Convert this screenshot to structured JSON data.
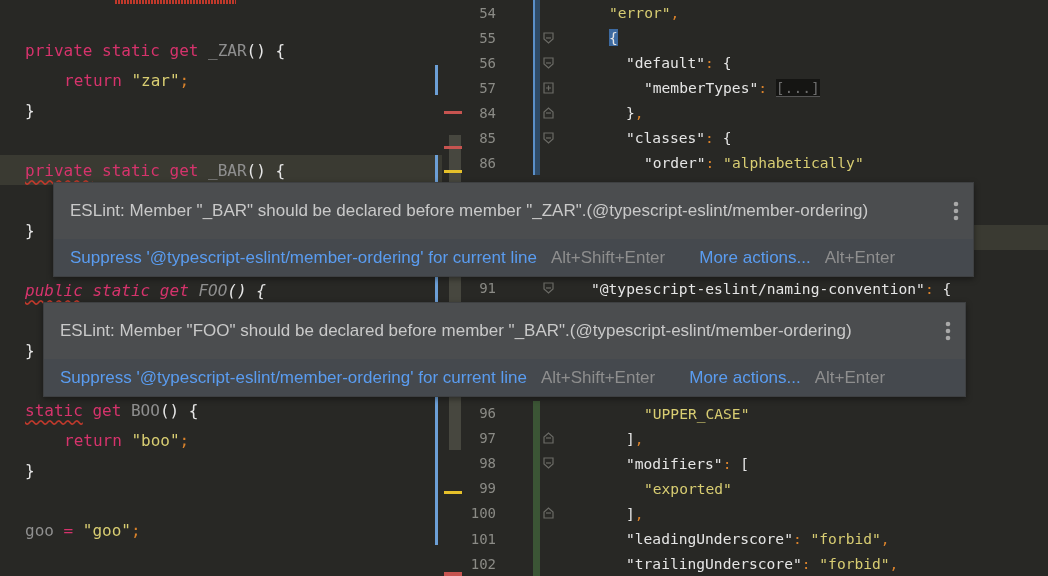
{
  "left_editor": {
    "lines": [
      {
        "kind": "blank"
      },
      {
        "kind": "code",
        "tokens": [
          {
            "kind": "keyword",
            "text": "private static get "
          },
          {
            "kind": "ident",
            "text": "_ZAR"
          },
          {
            "kind": "punct",
            "text": "() {"
          }
        ]
      },
      {
        "kind": "body",
        "modified": true,
        "tokens": [
          {
            "kind": "keyword",
            "text": "return "
          },
          {
            "kind": "string",
            "text": "\"zar\""
          },
          {
            "kind": "semi",
            "text": ";"
          }
        ]
      },
      {
        "kind": "code",
        "tokens": [
          {
            "kind": "punct",
            "text": "}"
          }
        ]
      },
      {
        "kind": "blank"
      },
      {
        "kind": "code",
        "current": true,
        "modified": true,
        "tokens": [
          {
            "kind": "keyword",
            "text": "private",
            "squiggle": true
          },
          {
            "kind": "keyword",
            "text": " static get "
          },
          {
            "kind": "ident",
            "text": "_BAR"
          },
          {
            "kind": "punct",
            "text": "() {"
          }
        ]
      },
      {
        "kind": "blank"
      },
      {
        "kind": "code",
        "tokens": [
          {
            "kind": "punct",
            "text": "}"
          }
        ]
      },
      {
        "kind": "blank"
      },
      {
        "kind": "code",
        "modified": true,
        "italic": true,
        "tokens": [
          {
            "kind": "keyword",
            "text": "public",
            "squiggle": true
          },
          {
            "kind": "keyword",
            "text": " static get "
          },
          {
            "kind": "ident",
            "text": "FOO"
          },
          {
            "kind": "punct",
            "text": "() {"
          }
        ]
      },
      {
        "kind": "blank"
      },
      {
        "kind": "code",
        "tokens": [
          {
            "kind": "punct",
            "text": "}"
          }
        ]
      },
      {
        "kind": "blank"
      },
      {
        "kind": "code",
        "modified": true,
        "tokens": [
          {
            "kind": "keyword",
            "text": "static",
            "squiggle": true
          },
          {
            "kind": "keyword",
            "text": " get "
          },
          {
            "kind": "ident",
            "text": "BOO"
          },
          {
            "kind": "punct",
            "text": "() {"
          }
        ]
      },
      {
        "kind": "body",
        "modified": true,
        "tokens": [
          {
            "kind": "keyword",
            "text": "return "
          },
          {
            "kind": "string",
            "text": "\"boo\""
          },
          {
            "kind": "semi",
            "text": ";"
          }
        ]
      },
      {
        "kind": "code",
        "modified": true,
        "tokens": [
          {
            "kind": "punct",
            "text": "}"
          }
        ]
      },
      {
        "kind": "blank",
        "modified": true
      },
      {
        "kind": "code",
        "modified": true,
        "tokens": [
          {
            "kind": "ident",
            "text": "goo"
          },
          {
            "kind": "keyword",
            "text": " = "
          },
          {
            "kind": "string",
            "text": "\"goo\""
          },
          {
            "kind": "semi",
            "text": ";"
          }
        ]
      },
      {
        "kind": "blank"
      }
    ]
  },
  "right_editor": {
    "lines": [
      {
        "kind": "section",
        "number": "54",
        "modified": true,
        "tokens": [
          {
            "kind": "string",
            "text": "\"error\""
          },
          {
            "kind": "semi",
            "text": ","
          }
        ]
      },
      {
        "kind": "section",
        "number": "55",
        "modified": true,
        "fold_open": true,
        "tokens": [
          {
            "kind": "punct",
            "text": "{",
            "matched": true
          }
        ]
      },
      {
        "kind": "entry",
        "number": "56",
        "modified": true,
        "fold_open": true,
        "tokens": [
          {
            "kind": "key",
            "text": "\"default\""
          },
          {
            "kind": "semi",
            "text": ": "
          },
          {
            "kind": "punct",
            "text": "{"
          }
        ]
      },
      {
        "kind": "item",
        "number": "57",
        "modified": true,
        "collapsed": true,
        "tokens": [
          {
            "kind": "key",
            "text": "\"memberTypes\""
          },
          {
            "kind": "semi",
            "text": ": "
          },
          {
            "kind": "folded",
            "text": "[...]"
          }
        ]
      },
      {
        "kind": "entry",
        "number": "84",
        "modified": true,
        "fold_close": true,
        "tokens": [
          {
            "kind": "punct",
            "text": "}"
          },
          {
            "kind": "semi",
            "text": ","
          }
        ]
      },
      {
        "kind": "entry",
        "number": "85",
        "modified": true,
        "fold_open": true,
        "tokens": [
          {
            "kind": "key",
            "text": "\"classes\""
          },
          {
            "kind": "semi",
            "text": ": "
          },
          {
            "kind": "punct",
            "text": "{"
          }
        ]
      },
      {
        "kind": "item",
        "number": "86",
        "modified": true,
        "tokens": [
          {
            "kind": "key",
            "text": "\"order\""
          },
          {
            "kind": "semi",
            "text": ": "
          },
          {
            "kind": "string",
            "text": "\"alphabetically\""
          }
        ]
      },
      {
        "kind": "hidden"
      },
      {
        "kind": "hidden"
      },
      {
        "kind": "hidden",
        "current": true
      },
      {
        "kind": "hidden"
      },
      {
        "kind": "outer",
        "number": "91",
        "fold_open": true,
        "tokens": [
          {
            "kind": "key",
            "text": "\"@typescript-eslint/naming-convention\""
          },
          {
            "kind": "semi",
            "text": ": "
          },
          {
            "kind": "punct",
            "text": "{"
          }
        ]
      },
      {
        "kind": "hidden"
      },
      {
        "kind": "hidden"
      },
      {
        "kind": "hidden"
      },
      {
        "kind": "hidden"
      },
      {
        "kind": "item",
        "number": "96",
        "added": true,
        "tokens": [
          {
            "kind": "string",
            "text": "\"UPPER_CASE\""
          }
        ]
      },
      {
        "kind": "entry",
        "number": "97",
        "added": true,
        "fold_close": true,
        "tokens": [
          {
            "kind": "punct",
            "text": "]"
          },
          {
            "kind": "semi",
            "text": ","
          }
        ]
      },
      {
        "kind": "entry",
        "number": "98",
        "added": true,
        "fold_open": true,
        "tokens": [
          {
            "kind": "key",
            "text": "\"modifiers\""
          },
          {
            "kind": "semi",
            "text": ": "
          },
          {
            "kind": "punct",
            "text": "["
          }
        ]
      },
      {
        "kind": "item",
        "number": "99",
        "added": true,
        "tokens": [
          {
            "kind": "string",
            "text": "\"exported\""
          }
        ]
      },
      {
        "kind": "entry",
        "number": "100",
        "added": true,
        "fold_close": true,
        "tokens": [
          {
            "kind": "punct",
            "text": "]"
          },
          {
            "kind": "semi",
            "text": ","
          }
        ]
      },
      {
        "kind": "entry",
        "number": "101",
        "added": true,
        "tokens": [
          {
            "kind": "key",
            "text": "\"leadingUnderscore\""
          },
          {
            "kind": "semi",
            "text": ": "
          },
          {
            "kind": "string",
            "text": "\"forbid\""
          },
          {
            "kind": "semi",
            "text": ","
          }
        ]
      },
      {
        "kind": "entry",
        "number": "102",
        "added": true,
        "tokens": [
          {
            "kind": "key",
            "text": "\"trailingUnderscore\""
          },
          {
            "kind": "semi",
            "text": ": "
          },
          {
            "kind": "string",
            "text": "\"forbid\""
          },
          {
            "kind": "semi",
            "text": ","
          }
        ]
      }
    ]
  },
  "popups": [
    {
      "message": "ESLint: Member \"_BAR\" should be declared before member \"_ZAR\".(@typescript-eslint/member-ordering)",
      "actions": [
        {
          "kind": "link",
          "text": "Suppress '@typescript-eslint/member-ordering' for current line"
        },
        {
          "kind": "shortcut",
          "text": "Alt+Shift+Enter"
        },
        {
          "kind": "link",
          "text": "More actions..."
        },
        {
          "kind": "shortcut",
          "text": "Alt+Enter"
        }
      ]
    },
    {
      "message": "ESLint: Member \"FOO\" should be declared before member \"_BAR\".(@typescript-eslint/member-ordering)",
      "actions": [
        {
          "kind": "link",
          "text": "Suppress '@typescript-eslint/member-ordering' for current line"
        },
        {
          "kind": "shortcut",
          "text": "Alt+Shift+Enter"
        },
        {
          "kind": "link",
          "text": "More actions..."
        },
        {
          "kind": "shortcut",
          "text": "Alt+Enter"
        }
      ]
    }
  ]
}
